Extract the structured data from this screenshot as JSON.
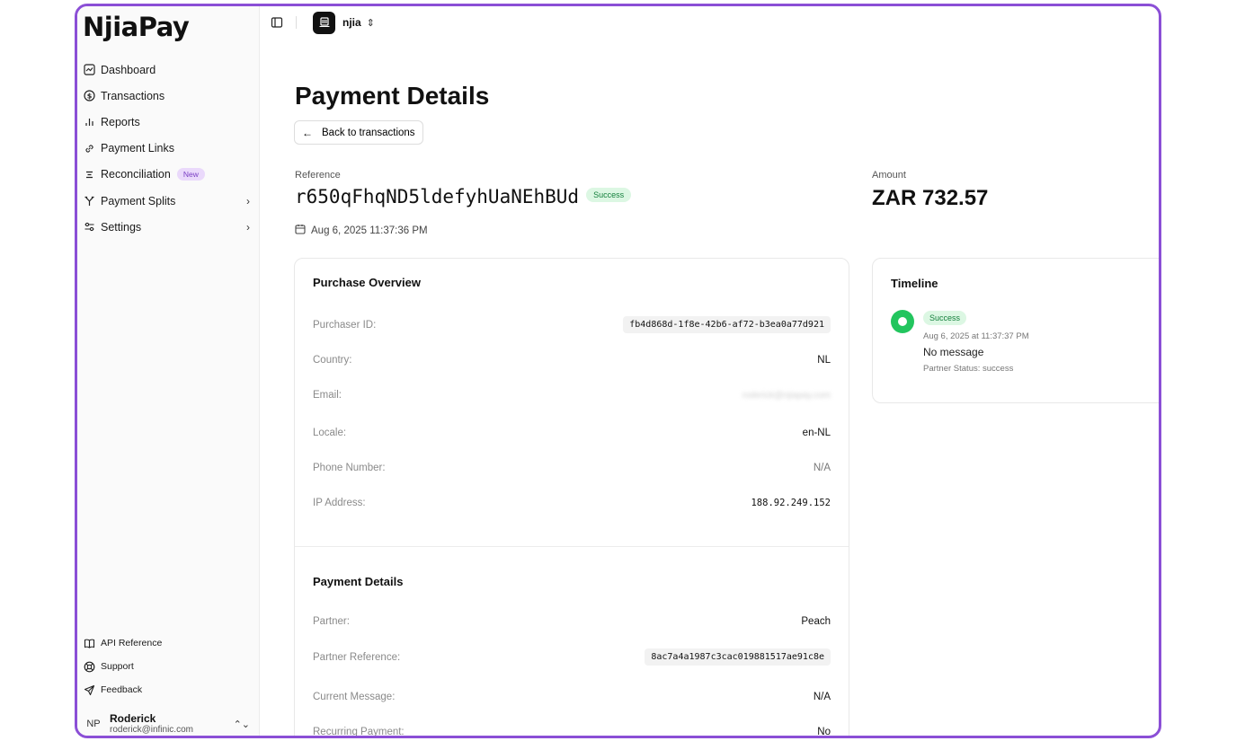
{
  "brand": {
    "name": "NjiaPay",
    "accent": "#8b4fd6"
  },
  "sidebar": {
    "items": [
      {
        "label": "Dashboard",
        "icon": "chart-square-icon"
      },
      {
        "label": "Transactions",
        "icon": "dollar-circle-icon"
      },
      {
        "label": "Reports",
        "icon": "bar-chart-icon"
      },
      {
        "label": "Payment Links",
        "icon": "link-icon"
      },
      {
        "label": "Reconciliation",
        "icon": "list-filter-icon",
        "badge": "New"
      },
      {
        "label": "Payment Splits",
        "icon": "split-icon"
      },
      {
        "label": "Settings",
        "icon": "sliders-icon"
      }
    ],
    "bottom": [
      {
        "label": "API Reference",
        "icon": "book-icon"
      },
      {
        "label": "Support",
        "icon": "lifebuoy-icon"
      },
      {
        "label": "Feedback",
        "icon": "send-icon"
      }
    ],
    "user": {
      "initials": "NP",
      "name": "Roderick",
      "email": "roderick@infinic.com"
    }
  },
  "topbar": {
    "org_name": "njia"
  },
  "page": {
    "title": "Payment Details",
    "back_label": "Back to transactions",
    "reference_label": "Reference",
    "reference": "r650qFhqND5ldefyhUaNEhBUd",
    "status": "Success",
    "date": "Aug 6, 2025 11:37:36 PM",
    "amount_label": "Amount",
    "amount": "ZAR 732.57"
  },
  "purchase_overview": {
    "title": "Purchase Overview",
    "rows": [
      {
        "label": "Purchaser ID:",
        "value": "fb4d868d-1f8e-42b6-af72-b3ea0a77d921"
      },
      {
        "label": "Country:",
        "value": "NL"
      },
      {
        "label": "Email:",
        "value": "roderick@njiapay.com"
      },
      {
        "label": "Locale:",
        "value": "en-NL"
      },
      {
        "label": "Phone Number:",
        "value": "N/A"
      },
      {
        "label": "IP Address:",
        "value": "188.92.249.152"
      }
    ]
  },
  "payment_details": {
    "title": "Payment Details",
    "rows": [
      {
        "label": "Partner:",
        "value": "Peach"
      },
      {
        "label": "Partner Reference:",
        "value": "8ac7a4a1987c3cac019881517ae91c8e"
      },
      {
        "label": "Current Message:",
        "value": "N/A"
      },
      {
        "label": "Recurring Payment:",
        "value": "No"
      }
    ]
  },
  "timeline": {
    "title": "Timeline",
    "events": [
      {
        "status": "Success",
        "time": "Aug 6, 2025 at 11:37:37 PM",
        "message": "No message",
        "partner_status": "Partner Status: success"
      }
    ]
  }
}
